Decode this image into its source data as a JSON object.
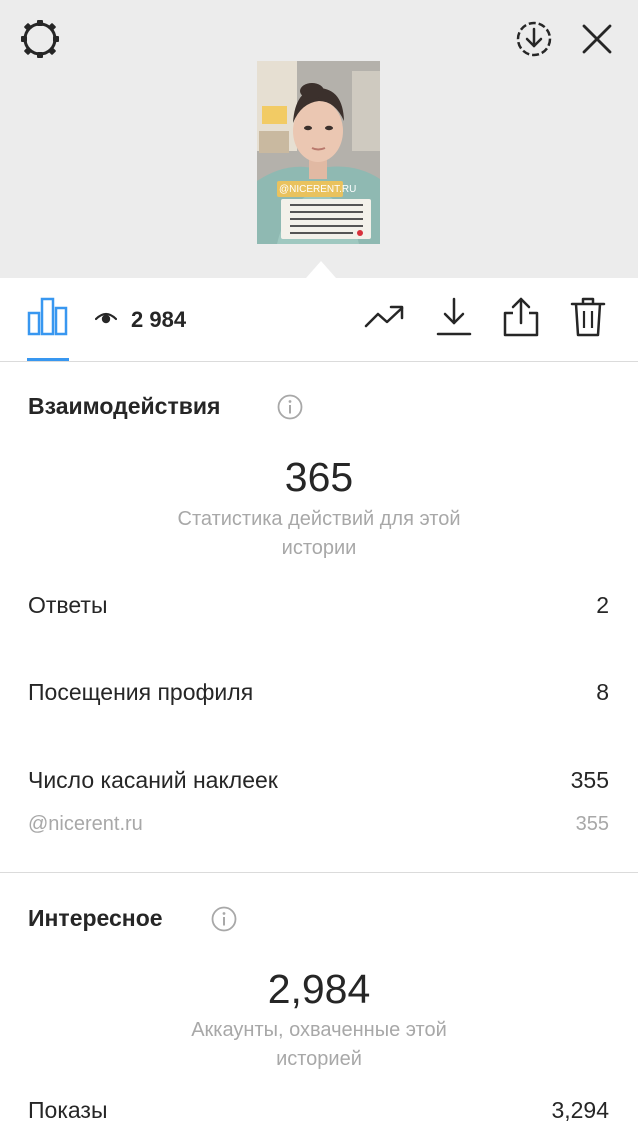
{
  "story": {
    "sticker_text": "@NICERENT.RU",
    "caption_lines": [
      "сейчас Юля покупает",
      "квартиру для себя и",
      "ребенка и рассказывает",
      "свою историю о поиске",
      "идеальной квартиры"
    ]
  },
  "top_icons": [
    "gear-icon",
    "save-circle-download-icon",
    "close-icon"
  ],
  "tabbar": {
    "viewers_count": "2 984",
    "icons": [
      "bar-chart-icon",
      "eye-icon",
      "trending-arrow-icon",
      "download-icon",
      "share-icon",
      "trash-icon"
    ],
    "active_color": "#3897f0"
  },
  "interactions": {
    "title": "Взаимодействия",
    "total": "365",
    "caption_line1": "Статистика действий для этой",
    "caption_line2": "истории",
    "rows": [
      {
        "label": "Ответы",
        "value": "2"
      },
      {
        "label": "Посещения профиля",
        "value": "8"
      },
      {
        "label": "Число касаний наклеек",
        "value": "355"
      }
    ],
    "sticker": {
      "label": "@nicerent.ru",
      "value": "355"
    }
  },
  "discovery": {
    "title": "Интересное",
    "total": "2,984",
    "caption_line1": "Аккаунты, охваченные этой",
    "caption_line2": "историей",
    "rows": [
      {
        "label": "Показы",
        "value": "3,294"
      }
    ]
  }
}
